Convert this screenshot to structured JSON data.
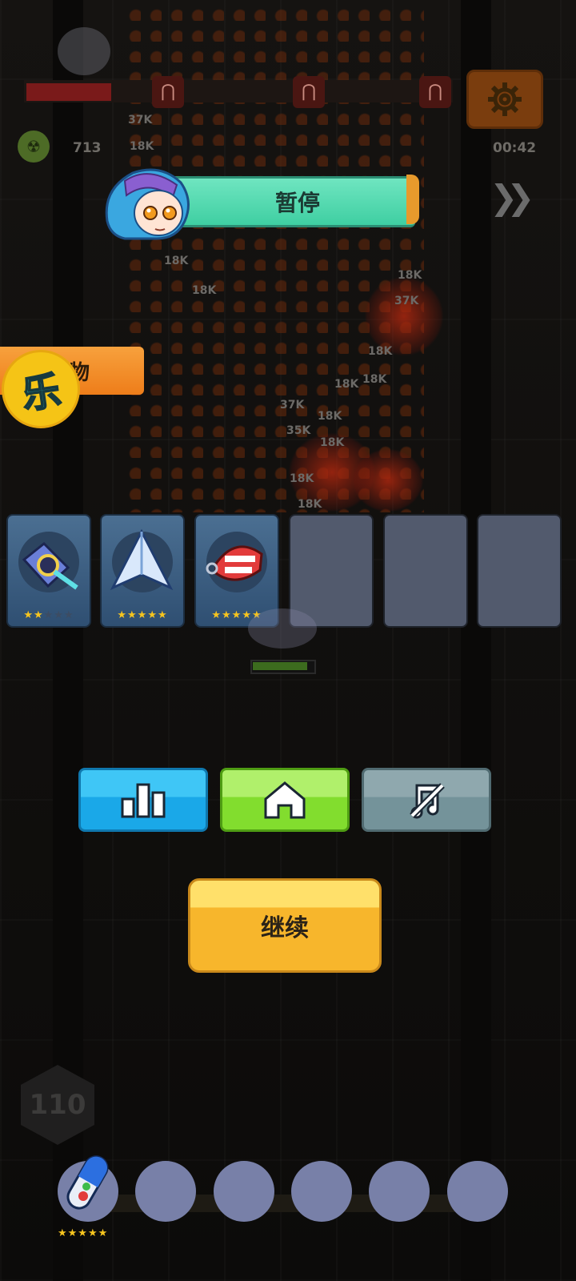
{
  "hud": {
    "kill_count": "713",
    "timer": "00:42",
    "icons": {
      "settings": "gear-icon",
      "fast_forward": "fast-forward-icon",
      "kills": "skull-icon",
      "magnet": "magnet-icon"
    }
  },
  "damage_numbers": [
    "37K",
    "18K",
    "18K",
    "18K",
    "18K",
    "37K",
    "18K",
    "18K",
    "18K",
    "37K",
    "18K",
    "35K",
    "18K",
    "18K",
    "18K"
  ],
  "pause_dialog": {
    "title": "暂停",
    "side_tab_label": "物",
    "side_badge_glyph": "乐",
    "skill_cards": [
      {
        "icon": "energy-cannon-icon",
        "stars": 2,
        "max_stars": 5
      },
      {
        "icon": "jet-fighter-icon",
        "stars": 5,
        "max_stars": 5
      },
      {
        "icon": "chattering-teeth-icon",
        "stars": 5,
        "max_stars": 5
      },
      {
        "empty": true
      },
      {
        "empty": true
      },
      {
        "empty": true
      }
    ],
    "buttons": {
      "stats_icon": "bar-chart-icon",
      "home_icon": "home-icon",
      "mute_icon": "sound-off-icon",
      "continue_label": "继续"
    }
  },
  "bottom": {
    "level": "110",
    "passive_slots": [
      {
        "icon": "capsule-pill-icon",
        "stars": 5
      },
      {
        "empty": true
      },
      {
        "empty": true
      },
      {
        "empty": true
      },
      {
        "empty": true
      },
      {
        "empty": true
      }
    ]
  },
  "colors": {
    "pause_banner": "#4fd8ae",
    "stats_button": "#1aa8e8",
    "home_button": "#82dd2e",
    "mute_button": "#74939a",
    "continue_button": "#f7b62c",
    "star": "#f7c51f",
    "empty_card": "#525a6d",
    "empty_slot": "#7880a8"
  }
}
